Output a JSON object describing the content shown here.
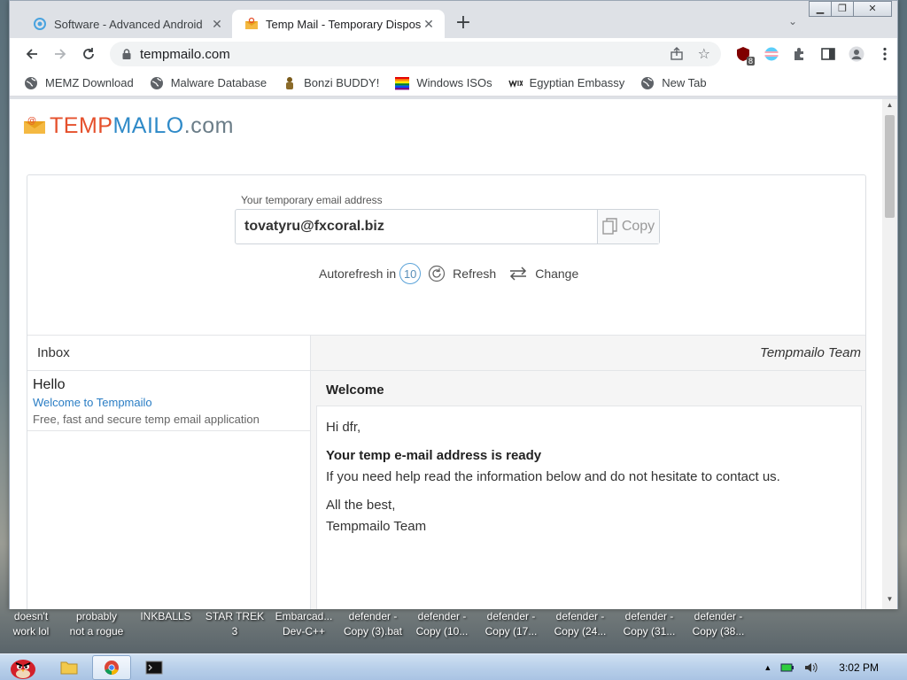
{
  "browser": {
    "tabs": [
      {
        "title": "Software - Advanced Android",
        "active": false
      },
      {
        "title": "Temp Mail - Temporary Dispos",
        "active": true
      }
    ],
    "new_tab_label": "+",
    "url": "tempmailo.com",
    "extension_badge": "8",
    "bookmarks": [
      {
        "label": "MEMZ Download",
        "icon": "globe-icon"
      },
      {
        "label": "Malware Database",
        "icon": "globe-icon"
      },
      {
        "label": "Bonzi BUDDY!",
        "icon": "bonzi-icon"
      },
      {
        "label": "Windows ISOs",
        "icon": "rainbow-flag-icon"
      },
      {
        "label": "Egyptian Embassy",
        "icon": "wix-icon"
      },
      {
        "label": "New Tab",
        "icon": "globe-icon"
      }
    ]
  },
  "site": {
    "logo": {
      "part1": "TEMP",
      "part2": "MAILO",
      "part3": ".com"
    },
    "address_label": "Your temporary email address",
    "email": "tovatyru@fxcoral.biz",
    "copy_label": "Copy",
    "autorefresh_label": "Autorefresh in",
    "countdown": "10",
    "refresh_label": "Refresh",
    "change_label": "Change",
    "inbox_label": "Inbox",
    "messages": [
      {
        "from": "Hello",
        "subject": "Welcome to Tempmailo",
        "preview": "Free, fast and secure temp email application"
      }
    ],
    "reader": {
      "sender": "Tempmailo Team",
      "subject": "Welcome",
      "greeting": "Hi dfr,",
      "headline": "Your temp e-mail address is ready",
      "line": "If you need help read the information below and do not hesitate to contact us.",
      "signoff1": "All the best,",
      "signoff2": "Tempmailo Team"
    }
  },
  "desktop": {
    "icons": [
      "doesn't\nwork lol",
      "probably\nnot a rogue",
      "INKBALLS",
      "STAR TREK\n3",
      "Embarcad...\nDev-C++",
      "defender -\nCopy (3).bat",
      "defender -\nCopy (10...",
      "defender -\nCopy (17...",
      "defender -\nCopy (24...",
      "defender -\nCopy (31...",
      "defender -\nCopy (38..."
    ]
  },
  "taskbar": {
    "clock": "3:02 PM"
  },
  "colors": {
    "logo_temp": "#e5502c",
    "logo_mailo": "#2f8ac8",
    "logo_com": "#6b7d88",
    "link": "#2a7dc4"
  }
}
